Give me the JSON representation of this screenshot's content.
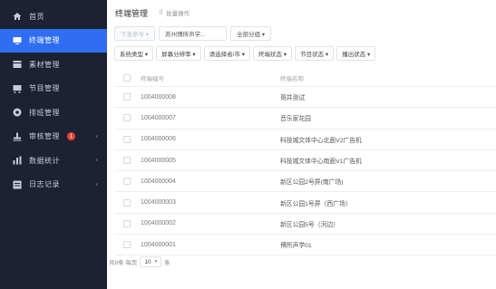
{
  "sidebar": {
    "items": [
      {
        "label": "首页",
        "icon": "home-icon",
        "active": false
      },
      {
        "label": "终端管理",
        "icon": "monitor-icon",
        "active": true
      },
      {
        "label": "素材管理",
        "icon": "folder-icon",
        "active": false
      },
      {
        "label": "节目管理",
        "icon": "program-icon",
        "active": false
      },
      {
        "label": "排班管理",
        "icon": "schedule-icon",
        "active": false
      },
      {
        "label": "审核管理",
        "icon": "audit-icon",
        "active": false,
        "badge": "1",
        "arrow": "‹"
      },
      {
        "label": "数据统计",
        "icon": "chart-icon",
        "active": false,
        "arrow": "‹"
      },
      {
        "label": "日志记录",
        "icon": "log-icon",
        "active": false,
        "arrow": "‹"
      }
    ]
  },
  "header": {
    "title": "终端管理",
    "batch_label": "批量操作",
    "batch_icon": "grid-icon"
  },
  "actions": {
    "send_command": "下发命令 ▾",
    "org_select": "苏州博所声学...",
    "group_select": "全部分组 ▾"
  },
  "filters": [
    "系统类型 ▾",
    "屏幕分辨率 ▾",
    "请选择省/市 ▾",
    "终端状态 ▾",
    "节目状态 ▾",
    "播出状态 ▾"
  ],
  "table": {
    "columns": [
      "终端编号",
      "终端名称"
    ],
    "rows": [
      {
        "id": "1004000008",
        "name": "哥并测试"
      },
      {
        "id": "1004000007",
        "name": "音乐家花园"
      },
      {
        "id": "1004000006",
        "name": "科技城文体中心北面V2广告机"
      },
      {
        "id": "1004000005",
        "name": "科技城文体中心南面V1广告机"
      },
      {
        "id": "1004000004",
        "name": "新区公园2号屏(南广场)"
      },
      {
        "id": "1004000003",
        "name": "新区公园1号屏（西广场）"
      },
      {
        "id": "1004000002",
        "name": "新区公园5号（河边）"
      },
      {
        "id": "1004000001",
        "name": "博所声学01"
      }
    ]
  },
  "pager": {
    "total_text": "共8条 每页",
    "page_size": "10",
    "unit": "条"
  },
  "colors": {
    "sidebar_bg": "#1d2233",
    "active_bg": "#2f6ef2",
    "badge": "#f04134"
  }
}
